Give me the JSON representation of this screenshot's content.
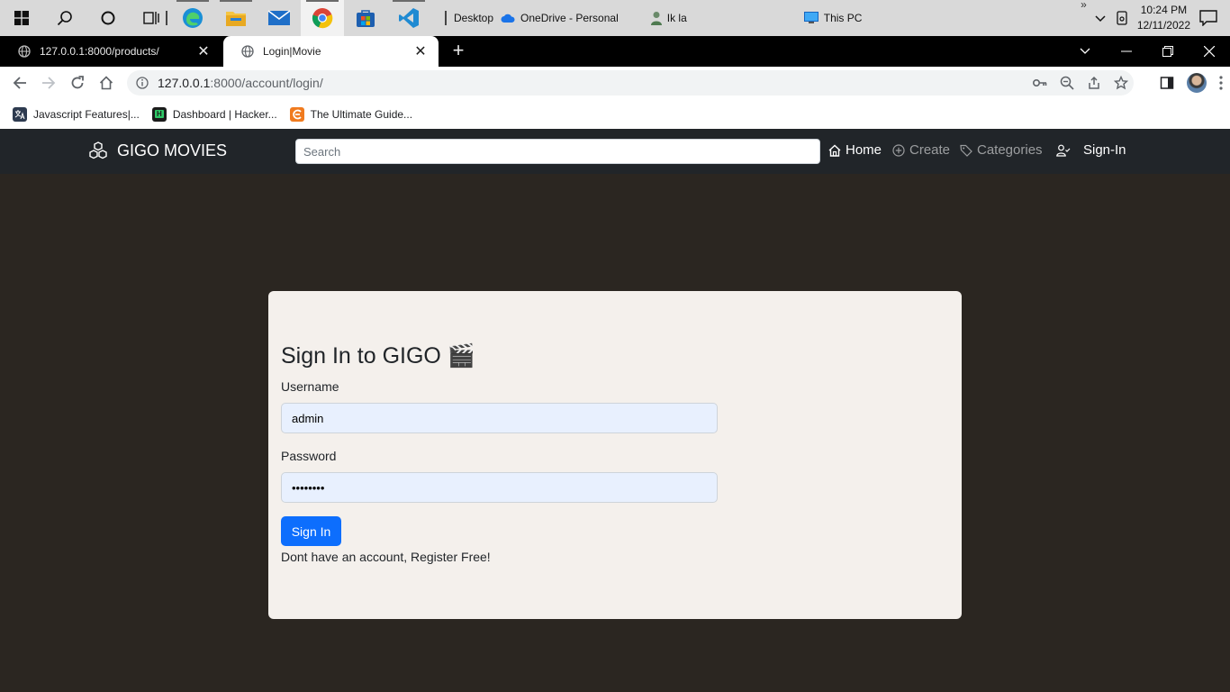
{
  "taskbar": {
    "desktop_label": "Desktop",
    "onedrive_label": "OneDrive - Personal",
    "user_label": "Ik la",
    "thispc_label": "This PC",
    "overflow_label": "»",
    "time": "10:24 PM",
    "date": "12/11/2022"
  },
  "browser": {
    "tabs": [
      {
        "title": "127.0.0.1:8000/products/",
        "close": "✕"
      },
      {
        "title": "Login|Movie",
        "close": "✕"
      }
    ],
    "new_tab": "+",
    "url_host": "127.0.0.1",
    "url_path": ":8000/account/login/",
    "bookmarks": [
      {
        "label": "Javascript Features|...",
        "color": "#2d3a4f"
      },
      {
        "label": "Dashboard | Hacker...",
        "color": "#1b1b1b",
        "badge": "H"
      },
      {
        "label": "The Ultimate Guide...",
        "color": "#f07b1f"
      }
    ]
  },
  "site": {
    "brand": "GIGO MOVIES",
    "search_placeholder": "Search",
    "nav": {
      "home": "Home",
      "create": "Create",
      "categories": "Categories",
      "signin": "Sign-In"
    }
  },
  "login": {
    "title": "Sign In to GIGO 🎬",
    "username_label": "Username",
    "username_value": "admin",
    "password_label": "Password",
    "password_value": "password",
    "submit_label": "Sign In",
    "register_text": "Dont have an account, ",
    "register_link": "Register Free!"
  },
  "colors": {
    "page_bg": "#2b2621",
    "navbar_bg": "#212529",
    "card_bg": "#f4f0ec",
    "primary": "#0d6efd",
    "autofill_bg": "#e8f0fe"
  }
}
